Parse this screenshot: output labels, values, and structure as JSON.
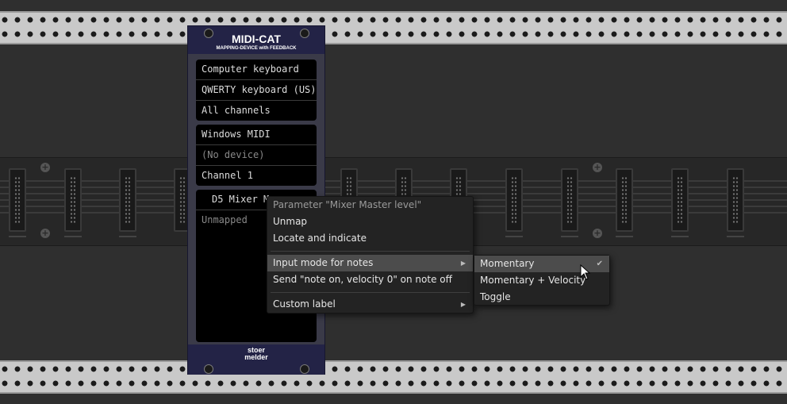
{
  "module": {
    "title": "MIDI-CAT",
    "subtitle": "MAPPING-DEVICE with FEEDBACK",
    "brand_line1": "stoer",
    "brand_line2": "melder",
    "input_group": [
      "Computer keyboard",
      "QWERTY keyboard (US)",
      "All channels"
    ],
    "output_group": [
      "Windows MIDI",
      "(No device)",
      "Channel 1"
    ],
    "mapping": {
      "slot_label": "D5 Mixer M",
      "status": "Unmapped"
    }
  },
  "context_menu": {
    "header": "Parameter \"Mixer Master level\"",
    "items": [
      {
        "label": "Unmap"
      },
      {
        "label": "Locate and indicate"
      },
      {
        "label": "Input mode for notes",
        "submenu": true
      },
      {
        "label": "Send \"note on, velocity 0\" on note off"
      },
      {
        "label": "Custom label",
        "submenu": true
      }
    ]
  },
  "submenu": {
    "items": [
      {
        "label": "Momentary",
        "checked": true
      },
      {
        "label": "Momentary + Velocity"
      },
      {
        "label": "Toggle"
      }
    ],
    "check_glyph": "✔"
  },
  "icons": {
    "submenu_arrow": "▶",
    "plus": "+"
  },
  "colors": {
    "module_panel": "#232346",
    "menu_bg": "#232323",
    "menu_highlight": "#4c4c4c"
  }
}
